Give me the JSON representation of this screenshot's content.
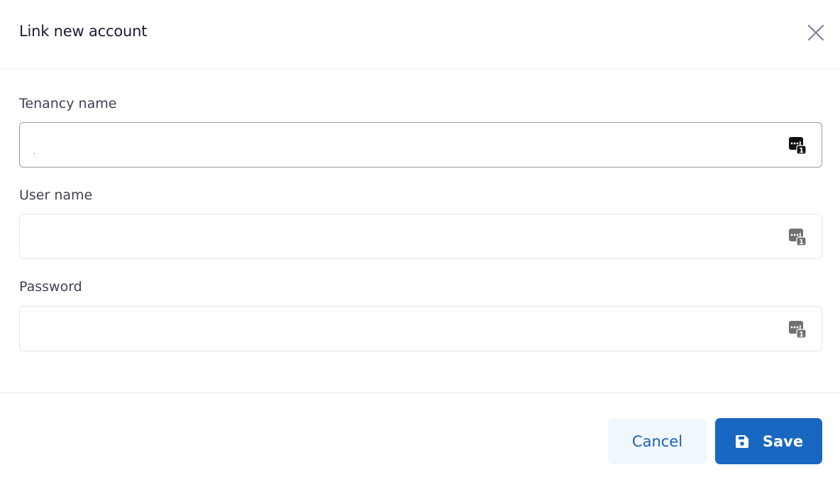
{
  "modal": {
    "title": "Link new account",
    "close_icon": "close-icon"
  },
  "form": {
    "fields": [
      {
        "label": "Tenancy name",
        "value": "",
        "placeholder": "",
        "focused": true,
        "icon": "password-manager-icon"
      },
      {
        "label": "User name",
        "value": "",
        "placeholder": "",
        "focused": false,
        "icon": "password-manager-icon"
      },
      {
        "label": "Password",
        "value": "",
        "placeholder": "",
        "focused": false,
        "icon": "password-manager-icon"
      }
    ]
  },
  "footer": {
    "cancel_label": "Cancel",
    "save_label": "Save",
    "save_icon": "floppy-disk-icon"
  },
  "colors": {
    "primary": "#1867c0",
    "cancel_bg": "#f0f7fd",
    "cancel_text": "#1a62b8",
    "title": "#181c32",
    "label": "#3f4254",
    "border": "#e4e6ef",
    "focused_border": "#9a9ca6"
  }
}
